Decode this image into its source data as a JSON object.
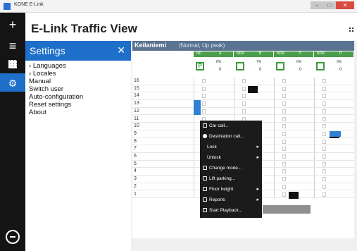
{
  "window": {
    "title": "KONE E-Link",
    "min": "–",
    "max": "□",
    "close": "✕"
  },
  "app": {
    "title": "E-Link Traffic View"
  },
  "leftbar": {
    "add": "+",
    "menu": "≡"
  },
  "settings": {
    "title": "Settings",
    "close": "✕",
    "items": [
      "Languages",
      "Locales",
      "Manual",
      "Switch user",
      "Auto-configuration",
      "Reset settings",
      "About"
    ]
  },
  "building": {
    "name": "Keilaniemi",
    "mode": "(Normal, Up peak)"
  },
  "cars": [
    {
      "tag": "ND",
      "letter": "A",
      "pct": "8%",
      "num": "0",
      "p": "P"
    },
    {
      "tag": "NDR",
      "letter": "B",
      "pct": "7%",
      "num": "0",
      "p": ""
    },
    {
      "tag": "NDR",
      "letter": "C",
      "pct": "6%",
      "num": "0",
      "p": ""
    },
    {
      "tag": "NDR",
      "letter": "D",
      "pct": "0%",
      "num": "0",
      "p": ""
    }
  ],
  "floors": [
    "16",
    "15",
    "14",
    "13",
    "12",
    "11",
    "10",
    "9",
    "8",
    "7",
    "6",
    "5",
    "4",
    "3",
    "2",
    "1"
  ],
  "context_menu": [
    {
      "label": "Car call...",
      "icon": "car-call-icon",
      "arrow": ""
    },
    {
      "label": "Destination call...",
      "icon": "destination-call-icon",
      "arrow": ""
    },
    {
      "label": "Lock",
      "icon": "",
      "arrow": "▸"
    },
    {
      "label": "Unlock",
      "icon": "",
      "arrow": "▸"
    },
    {
      "label": "Change mode...",
      "icon": "change-mode-icon",
      "arrow": ""
    },
    {
      "label": "Lift parking...",
      "icon": "lift-parking-icon",
      "arrow": ""
    },
    {
      "label": "Floor height",
      "icon": "floor-height-icon",
      "arrow": "▸"
    },
    {
      "label": "Reports",
      "icon": "reports-icon",
      "arrow": "▸"
    },
    {
      "label": "Start Playback...",
      "icon": "play-icon",
      "arrow": ""
    }
  ],
  "colors": {
    "accent": "#1e6fc9",
    "header": "#5a7391",
    "car_ok": "#3e9a3e",
    "menu_bg": "#1b1b1b"
  }
}
